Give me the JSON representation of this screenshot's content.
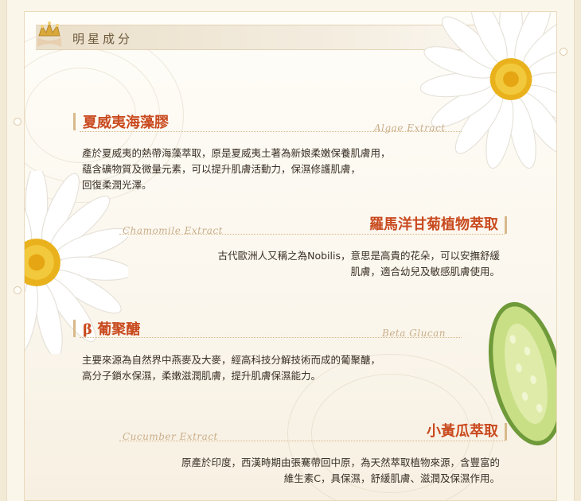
{
  "header": {
    "title": "明星成分"
  },
  "sections": [
    {
      "title": "夏威夷海藻膠",
      "script": "Algae Extract",
      "lines": [
        "產於夏威夷的熱帶海藻萃取，原是夏威夷土著為新娘柔嫩保養肌膚用，",
        "蘊含礦物質及微量元素，可以提升肌膚活動力，保濕修護肌膚，",
        "回復柔潤光澤。"
      ]
    },
    {
      "title": "羅馬洋甘菊植物萃取",
      "script": "Chamomile Extract",
      "lines": [
        "古代歐洲人又稱之為Nobilis，意思是高貴的花朵，可以安撫舒緩",
        "肌膚，適合幼兒及敏感肌膚使用。"
      ]
    },
    {
      "title": "β 葡聚醣",
      "script": "Beta Glucan",
      "lines": [
        "主要來源為自然界中燕麥及大麥，經高科技分解技術而成的葡聚醣，",
        "高分子鎖水保濕，柔嫩滋潤肌膚，提升肌膚保濕能力。"
      ]
    },
    {
      "title": "小黃瓜萃取",
      "script": "Cucumber Extract",
      "lines": [
        "原產於印度，西漢時期由張騫帶回中原，為天然萃取植物來源，含豐富的",
        "維生素C，具保濕，舒緩肌膚、滋潤及保濕作用。"
      ]
    }
  ],
  "colors": {
    "title": "#c94a1f",
    "text": "#3a3026",
    "script": "#c9ae8a",
    "accent": "#d8b98a"
  },
  "icons": [
    "crown-icon",
    "daisy-flower",
    "cucumber-slice"
  ]
}
